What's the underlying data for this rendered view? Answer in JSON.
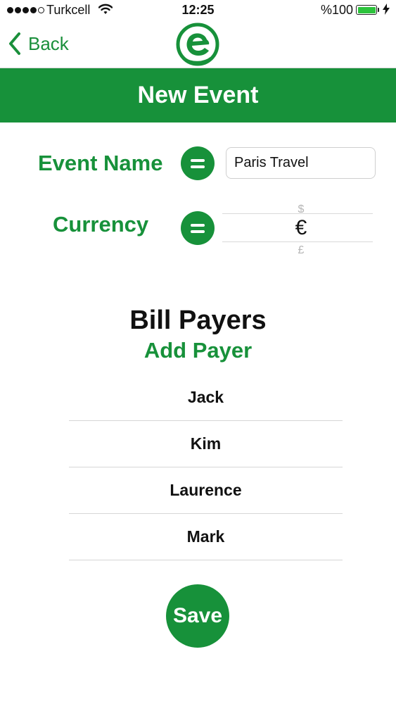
{
  "status_bar": {
    "carrier": "Turkcell",
    "time": "12:25",
    "battery_percent": "%100",
    "battery_level": 1.0,
    "signal_bars_filled": 4,
    "signal_bars_total": 5
  },
  "nav": {
    "back_label": "Back",
    "logo_icon": "app-logo-e-icon"
  },
  "page": {
    "title": "New Event"
  },
  "form": {
    "event_name_label": "Event Name",
    "event_name_value": "Paris Travel",
    "currency_label": "Currency",
    "currency_picker": {
      "option_above": "$",
      "selected": "€",
      "option_below": "£"
    }
  },
  "payers": {
    "title": "Bill Payers",
    "add_label": "Add Payer",
    "items": [
      {
        "name": "Jack"
      },
      {
        "name": "Kim"
      },
      {
        "name": "Laurence"
      },
      {
        "name": "Mark"
      }
    ]
  },
  "actions": {
    "save_label": "Save"
  },
  "colors": {
    "accent": "#17913a",
    "on_accent": "#ffffff",
    "separator": "#d6d6d6"
  }
}
